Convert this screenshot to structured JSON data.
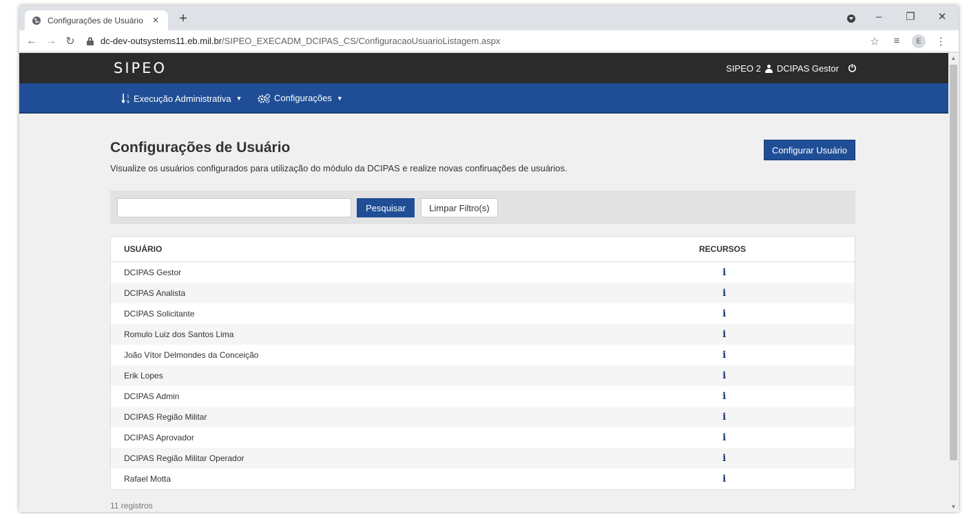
{
  "browser": {
    "tab_title": "Configurações de Usuário",
    "tab_close": "×",
    "new_tab": "+",
    "url_host": "dc-dev-outsystems11.eb.mil.br",
    "url_path": "/SIPEO_EXECADM_DCIPAS_CS/ConfiguracaoUsuarioListagem.aspx",
    "profile_initial": "E"
  },
  "header": {
    "brand": "SIPEO",
    "app_name": "SIPEO 2",
    "user_name": "DCIPAS Gestor"
  },
  "menu": {
    "items": [
      {
        "label": "Execução Administrativa"
      },
      {
        "label": "Configurações"
      }
    ]
  },
  "page": {
    "title": "Configurações de Usuário",
    "subtitle": "Visualize os usuários configurados para utilização do módulo da DCIPAS e realize novas confiruações de usuários.",
    "configure_button": "Configurar Usuário"
  },
  "filter": {
    "search_value": "",
    "search_button": "Pesquisar",
    "clear_button": "Limpar Filtro(s)"
  },
  "table": {
    "col_user": "USUÁRIO",
    "col_resources": "RECURSOS",
    "info_glyph": "i",
    "rows": [
      {
        "user": "DCIPAS Gestor"
      },
      {
        "user": "DCIPAS Analista"
      },
      {
        "user": "DCIPAS Solicitante"
      },
      {
        "user": "Romulo Luiz dos Santos Lima"
      },
      {
        "user": "João Vítor Delmondes da Conceição"
      },
      {
        "user": "Erik Lopes"
      },
      {
        "user": "DCIPAS Admin"
      },
      {
        "user": "DCIPAS Região Militar"
      },
      {
        "user": "DCIPAS Aprovador"
      },
      {
        "user": "DCIPAS Região Militar Operador"
      },
      {
        "user": "Rafael Motta"
      }
    ]
  },
  "footer": {
    "count": "11 registros"
  },
  "colors": {
    "primary": "#1f4e96",
    "topbar": "#2b2b2b",
    "info_icon": "#1f3f78"
  }
}
